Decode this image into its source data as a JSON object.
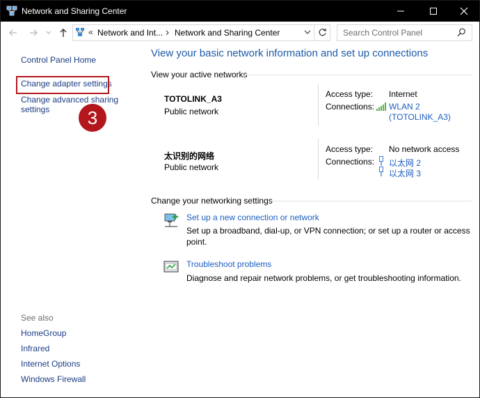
{
  "window": {
    "title": "Network and Sharing Center"
  },
  "address": {
    "overflow": "«",
    "crumb1": "Network and Int...",
    "crumb2": "Network and Sharing Center"
  },
  "search": {
    "placeholder": "Search Control Panel"
  },
  "sidebar": {
    "home": "Control Panel Home",
    "change_adapter": "Change adapter settings",
    "change_advanced_line1": "Change advanced sharing",
    "change_advanced_line2": "settings",
    "see_also": "See also",
    "see_also_links": [
      "HomeGroup",
      "Infrared",
      "Internet Options",
      "Windows Firewall"
    ]
  },
  "annotation": {
    "step_number": "3",
    "color": "#b3161b"
  },
  "main": {
    "title": "View your basic network information and set up connections",
    "active_networks_label": "View your active networks",
    "networks": [
      {
        "name": "TOTOLINK_A3",
        "type": "Public network",
        "access_type_label": "Access type:",
        "access_type": "Internet",
        "connections_label": "Connections:",
        "connections": [
          "WLAN 2",
          "(TOTOLINK_A3)"
        ]
      },
      {
        "name": "太识别的网络",
        "type": "Public network",
        "access_type_label": "Access type:",
        "access_type": "No network access",
        "connections_label": "Connections:",
        "connections": [
          "以太网 2",
          "以太网 3"
        ]
      }
    ],
    "change_settings_label": "Change your networking settings",
    "settings": [
      {
        "link": "Set up a new connection or network",
        "desc": "Set up a broadband, dial-up, or VPN connection; or set up a router or access point."
      },
      {
        "link": "Troubleshoot problems",
        "desc": "Diagnose and repair network problems, or get troubleshooting information."
      }
    ]
  },
  "colors": {
    "link": "#1c5fbf",
    "title": "#1e5aa8",
    "sidebar_link": "#1c3d84"
  }
}
